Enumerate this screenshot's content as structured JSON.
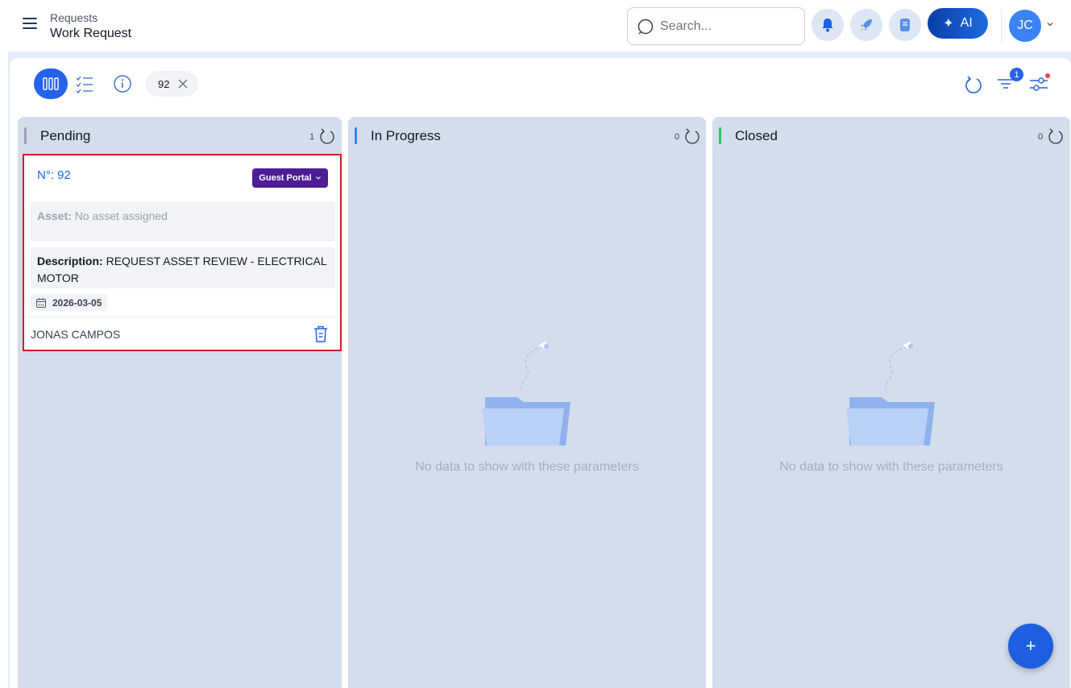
{
  "header": {
    "breadcrumb_parent": "Requests",
    "page_title": "Work Request",
    "search_placeholder": "Search...",
    "ai_label": "AI",
    "user_initials": "JC"
  },
  "toolbar": {
    "filter_chip_label": "92",
    "filter_badge_count": "1"
  },
  "columns": [
    {
      "title": "Pending",
      "count": "1",
      "accent": "#9ca3af"
    },
    {
      "title": "In Progress",
      "count": "0",
      "accent": "#3b82f6",
      "empty_text": "No data to show with these parameters"
    },
    {
      "title": "Closed",
      "count": "0",
      "accent": "#22c55e",
      "empty_text": "No data to show with these parameters"
    }
  ],
  "card": {
    "number": "N°: 92",
    "source": "Guest Portal",
    "asset_label": "Asset:",
    "asset_value": "No asset assigned",
    "description_label": "Description:",
    "description_value": "REQUEST ASSET REVIEW - ELECTRICAL MOTOR",
    "date": "2026-03-05",
    "assignee": "JONAS CAMPOS"
  },
  "fab_label": "+",
  "colors": {
    "primary": "#2563eb",
    "column_bg": "#d3ddeb",
    "source_badge": "#4c1d95",
    "highlight": "#e0181e"
  }
}
